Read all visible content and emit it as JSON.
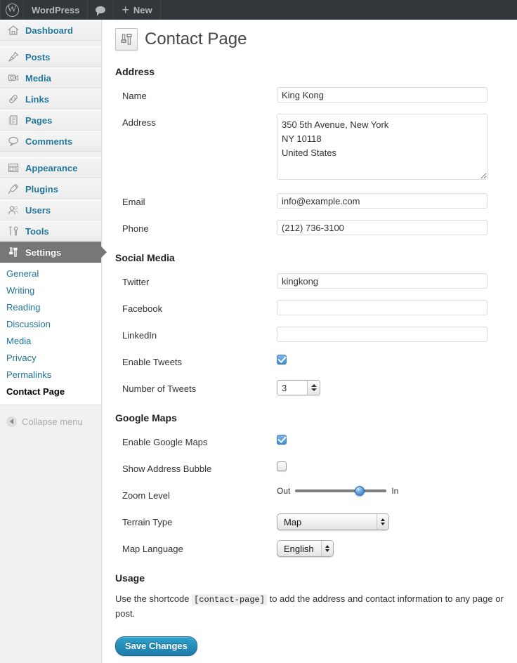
{
  "adminbar": {
    "logo_icon": "wordpress-logo-icon",
    "site_name": "WordPress",
    "comments_icon": "comment-bubble-icon",
    "new_label": "New"
  },
  "sidebar": {
    "items": [
      {
        "label": "Dashboard",
        "icon": "dashboard-home-icon",
        "current": false,
        "sep": false
      },
      {
        "label": "Posts",
        "icon": "pin-icon",
        "current": false,
        "sep": true
      },
      {
        "label": "Media",
        "icon": "camera-icon",
        "current": false,
        "sep": false
      },
      {
        "label": "Links",
        "icon": "link-chain-icon",
        "current": false,
        "sep": false
      },
      {
        "label": "Pages",
        "icon": "page-document-icon",
        "current": false,
        "sep": false
      },
      {
        "label": "Comments",
        "icon": "comment-bubble-icon",
        "current": false,
        "sep": false
      },
      {
        "label": "Appearance",
        "icon": "appearance-layout-icon",
        "current": false,
        "sep": true
      },
      {
        "label": "Plugins",
        "icon": "plug-icon",
        "current": false,
        "sep": false
      },
      {
        "label": "Users",
        "icon": "users-icon",
        "current": false,
        "sep": false
      },
      {
        "label": "Tools",
        "icon": "tools-icon",
        "current": false,
        "sep": false
      },
      {
        "label": "Settings",
        "icon": "settings-sliders-icon",
        "current": true,
        "sep": false
      }
    ],
    "submenu": [
      {
        "label": "General",
        "current": false
      },
      {
        "label": "Writing",
        "current": false
      },
      {
        "label": "Reading",
        "current": false
      },
      {
        "label": "Discussion",
        "current": false
      },
      {
        "label": "Media",
        "current": false
      },
      {
        "label": "Privacy",
        "current": false
      },
      {
        "label": "Permalinks",
        "current": false
      },
      {
        "label": "Contact Page",
        "current": true
      }
    ],
    "collapse_label": "Collapse menu",
    "collapse_icon": "collapse-arrow-icon"
  },
  "page": {
    "icon": "settings-sliders-icon",
    "title": "Contact Page"
  },
  "sections": {
    "address": {
      "heading": "Address",
      "name_label": "Name",
      "name_value": "King Kong",
      "address_label": "Address",
      "address_value": "350 5th Avenue, New York\nNY 10118\nUnited States",
      "email_label": "Email",
      "email_value": "info@example.com",
      "phone_label": "Phone",
      "phone_value": "(212) 736-3100"
    },
    "social": {
      "heading": "Social Media",
      "twitter_label": "Twitter",
      "twitter_value": "kingkong",
      "facebook_label": "Facebook",
      "facebook_value": "",
      "linkedin_label": "LinkedIn",
      "linkedin_value": "",
      "enable_tweets_label": "Enable Tweets",
      "enable_tweets_checked": true,
      "num_tweets_label": "Number of Tweets",
      "num_tweets_value": "3"
    },
    "maps": {
      "heading": "Google Maps",
      "enable_maps_label": "Enable Google Maps",
      "enable_maps_checked": true,
      "show_bubble_label": "Show Address Bubble",
      "show_bubble_checked": false,
      "zoom_label": "Zoom Level",
      "zoom_min_label": "Out",
      "zoom_max_label": "In",
      "zoom_percent": 73,
      "terrain_label": "Terrain Type",
      "terrain_value": "Map",
      "language_label": "Map Language",
      "language_value": "English"
    },
    "usage": {
      "heading": "Usage",
      "text_before": "Use the shortcode",
      "shortcode": "[contact-page]",
      "text_after": "to add the address and contact information to any page or post."
    }
  },
  "actions": {
    "save_label": "Save Changes"
  },
  "colors": {
    "adminbar_bg": "#32373c",
    "link_blue": "#21759b",
    "current_menu_bg": "#777777",
    "button_blue": "#1c7ba8",
    "checkbox_blue": "#3e8fd6"
  }
}
